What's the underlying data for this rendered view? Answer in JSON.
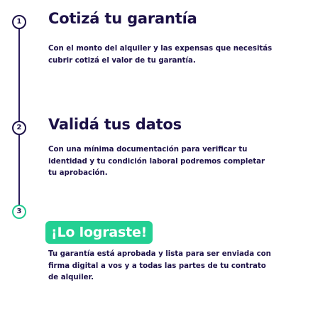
{
  "steps": [
    {
      "number": "1",
      "title": "Cotizá tu garantía",
      "description": "Con el monto del alquiler y las expensas que necesitás cubrir cotizá el valor de tu garantía."
    },
    {
      "number": "2",
      "title": "Validá tus datos",
      "description": "Con una mínima documentación para verificar tu identidad y tu condición laboral podremos completar tu aprobación."
    },
    {
      "number": "3",
      "title": "¡Lo lograste!",
      "description": "Tu garantía está aprobada y lista para ser enviada con firma digital a vos y a todas las partes de tu contrato de alquiler."
    }
  ],
  "colors": {
    "text": "#1c1147",
    "accent": "#24d093"
  }
}
